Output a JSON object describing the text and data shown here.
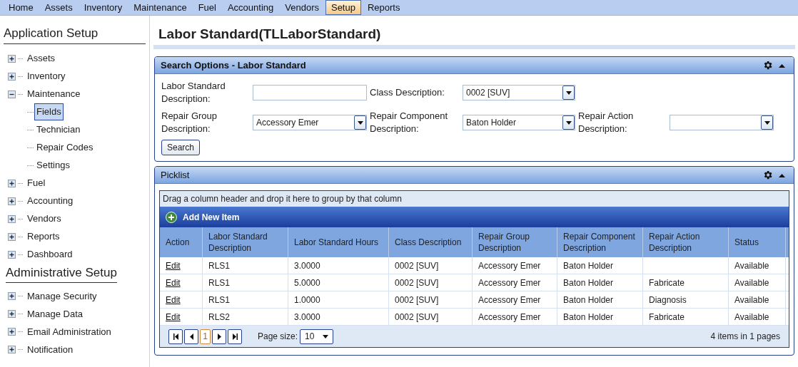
{
  "menu": [
    {
      "label": "Home",
      "selected": false
    },
    {
      "label": "Assets",
      "selected": false
    },
    {
      "label": "Inventory",
      "selected": false
    },
    {
      "label": "Maintenance",
      "selected": false
    },
    {
      "label": "Fuel",
      "selected": false
    },
    {
      "label": "Accounting",
      "selected": false
    },
    {
      "label": "Vendors",
      "selected": false
    },
    {
      "label": "Setup",
      "selected": true
    },
    {
      "label": "Reports",
      "selected": false
    }
  ],
  "sidebar": {
    "sections": [
      {
        "title": "Application Setup",
        "items": [
          {
            "label": "Assets",
            "expanded": false,
            "selected": false
          },
          {
            "label": "Inventory",
            "expanded": false,
            "selected": false
          },
          {
            "label": "Maintenance",
            "expanded": true,
            "selected": false,
            "children": [
              {
                "label": "Fields",
                "selected": true
              },
              {
                "label": "Technician",
                "selected": false
              },
              {
                "label": "Repair Codes",
                "selected": false
              },
              {
                "label": "Settings",
                "selected": false
              }
            ]
          },
          {
            "label": "Fuel",
            "expanded": false,
            "selected": false
          },
          {
            "label": "Accounting",
            "expanded": false,
            "selected": false
          },
          {
            "label": "Vendors",
            "expanded": false,
            "selected": false
          },
          {
            "label": "Reports",
            "expanded": false,
            "selected": false
          },
          {
            "label": "Dashboard",
            "expanded": false,
            "selected": false
          }
        ]
      },
      {
        "title": "Administrative Setup",
        "items": [
          {
            "label": "Manage Security",
            "expanded": false,
            "selected": false
          },
          {
            "label": "Manage Data",
            "expanded": false,
            "selected": false
          },
          {
            "label": "Email Administration",
            "expanded": false,
            "selected": false
          },
          {
            "label": "Notification",
            "expanded": false,
            "selected": false
          }
        ]
      }
    ]
  },
  "page_title": "Labor Standard(TLLaborStandard)",
  "search_panel": {
    "title": "Search Options - Labor Standard",
    "fields": [
      {
        "label": "Labor Standard Description:",
        "kind": "text"
      },
      {
        "label": "Class Description:",
        "kind": "select",
        "value": "0002 [SUV]"
      },
      {
        "label": "Repair Group Description:",
        "kind": "select",
        "value": "Accessory Emer"
      },
      {
        "label": "Repair Component Description:",
        "kind": "select",
        "value": "Baton Holder"
      },
      {
        "label": "Repair Action Description:",
        "kind": "select"
      }
    ],
    "button": "Search"
  },
  "picklist": {
    "title": "Picklist",
    "group_hint": "Drag a column header and drop it here to group by that column",
    "add_button": "Add New Item",
    "columns": [
      "Action",
      "Labor Standard Description",
      "Labor Standard Hours",
      "Class Description",
      "Repair Group Description",
      "Repair Component Description",
      "Repair Action Description",
      "Status"
    ],
    "rows": [
      {
        "cells": [
          "Edit",
          "RLS1",
          "3.0000",
          "0002 [SUV]",
          "Accessory Emer",
          "Baton Holder",
          "",
          "Available"
        ]
      },
      {
        "cells": [
          "Edit",
          "RLS1",
          "5.0000",
          "0002 [SUV]",
          "Accessory Emer",
          "Baton Holder",
          "Fabricate",
          "Available"
        ]
      },
      {
        "cells": [
          "Edit",
          "RLS1",
          "1.0000",
          "0002 [SUV]",
          "Accessory Emer",
          "Baton Holder",
          "Diagnosis",
          "Available"
        ]
      },
      {
        "cells": [
          "Edit",
          "RLS2",
          "3.0000",
          "0002 [SUV]",
          "Accessory Emer",
          "Baton Holder",
          "Fabricate",
          "Available"
        ]
      }
    ],
    "pager": {
      "current_page": "1",
      "page_size_label": "Page size:",
      "page_size": "10",
      "summary": "4 items in 1 pages"
    }
  }
}
